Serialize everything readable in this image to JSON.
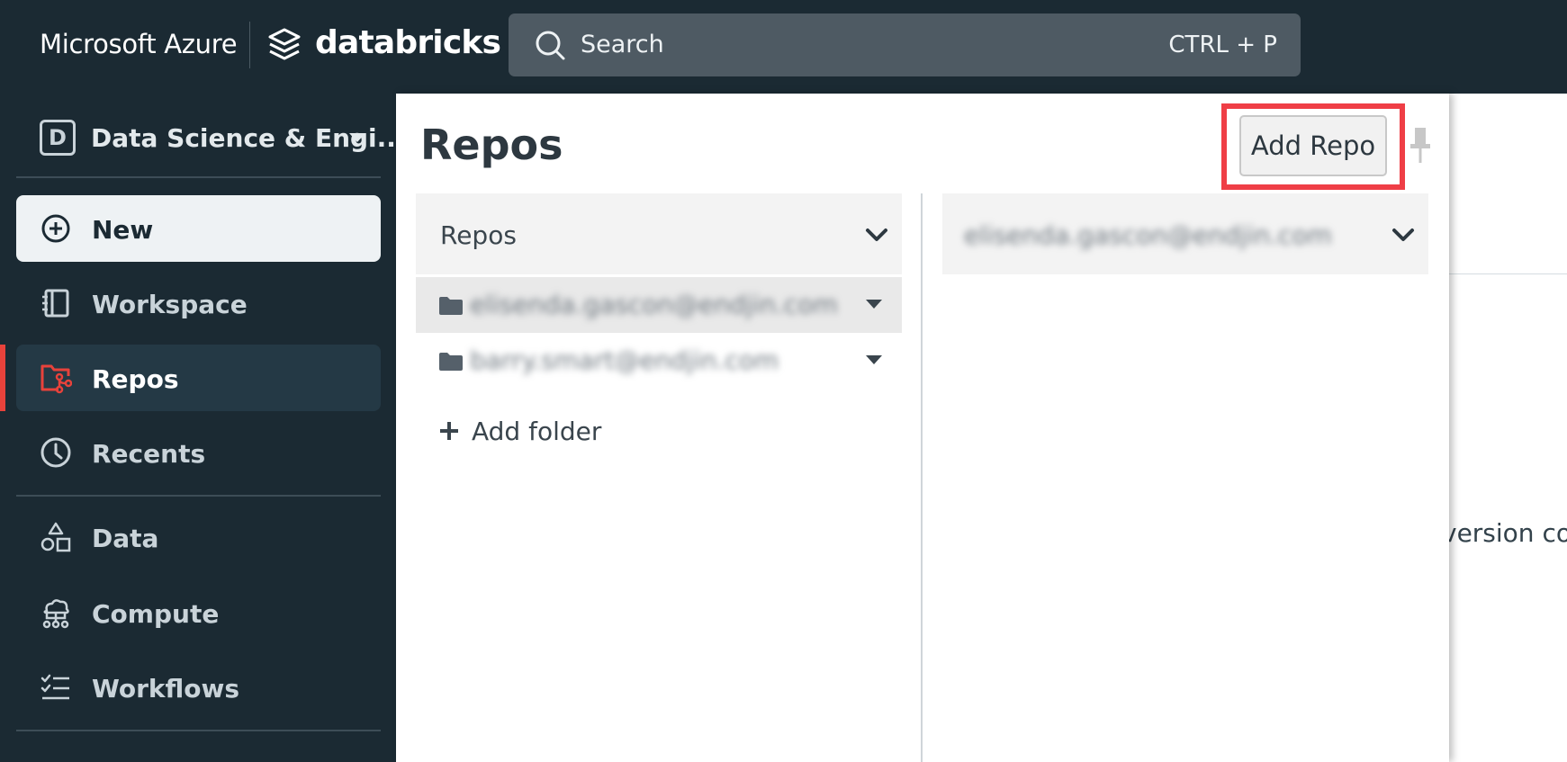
{
  "topbar": {
    "cloud_brand": "Microsoft Azure",
    "product_brand": "databricks",
    "search": {
      "placeholder": "Search",
      "shortcut": "CTRL + P"
    }
  },
  "sidebar": {
    "workspace_switcher": {
      "badge": "D",
      "label": "Data Science & Engi..."
    },
    "new_button": {
      "label": "New",
      "icon": "plus-circle-icon"
    },
    "items": [
      {
        "label": "Workspace",
        "icon": "workspace-icon",
        "active": false
      },
      {
        "label": "Repos",
        "icon": "repos-icon",
        "active": true
      },
      {
        "label": "Recents",
        "icon": "clock-icon",
        "active": false
      },
      {
        "label": "Data",
        "icon": "data-shapes-icon",
        "active": false
      },
      {
        "label": "Compute",
        "icon": "compute-cloud-icon",
        "active": false
      },
      {
        "label": "Workflows",
        "icon": "workflows-icon",
        "active": false
      }
    ]
  },
  "repos_panel": {
    "title": "Repos",
    "add_repo_button": "Add Repo",
    "left_column": {
      "header": "Repos",
      "folders": [
        {
          "label": "elisenda.gascon@endjin.com",
          "selected": true
        },
        {
          "label": "barry.smart@endjin.com",
          "selected": false
        }
      ],
      "add_folder_label": "Add folder"
    },
    "right_column": {
      "header": "elisenda.gascon@endjin.com"
    }
  },
  "background_page": {
    "partial_text": "version con"
  },
  "colors": {
    "topbar_bg": "#1b2a33",
    "sidebar_bg": "#1b2a33",
    "active_accent": "#e8423b",
    "highlight_box": "#ef3e46"
  }
}
